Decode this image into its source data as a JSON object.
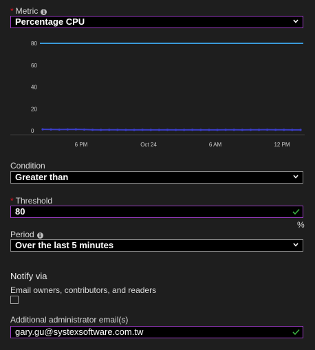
{
  "metric": {
    "label": "Metric",
    "value": "Percentage CPU"
  },
  "chart_data": {
    "type": "line",
    "x_ticks": [
      "6 PM",
      "Oct 24",
      "6 AM",
      "12 PM"
    ],
    "y_ticks": [
      0,
      20,
      40,
      60,
      80
    ],
    "ylim": [
      0,
      80
    ],
    "threshold": 80,
    "series": [
      {
        "values": [
          1.2,
          1.1,
          1.0,
          1.1,
          1.2,
          1.0,
          0.8,
          0.7,
          0.8,
          0.8,
          0.7,
          0.7,
          0.8,
          0.7,
          0.7,
          0.8,
          0.7,
          0.7,
          0.8,
          0.7,
          0.7,
          0.7,
          0.8,
          0.8,
          0.7,
          0.8,
          0.8,
          0.9,
          0.8,
          0.8,
          0.7,
          0.7
        ]
      }
    ],
    "colors": {
      "threshold": "#3a9ad9",
      "series": "#3b3ec9"
    }
  },
  "condition": {
    "label": "Condition",
    "value": "Greater than"
  },
  "threshold": {
    "label": "Threshold",
    "value": "80",
    "unit": "%"
  },
  "period": {
    "label": "Period",
    "value": "Over the last 5 minutes"
  },
  "notify": {
    "title": "Notify via",
    "email_owners_label": "Email owners, contributors, and readers",
    "email_owners_checked": false,
    "admin_email_label": "Additional administrator email(s)",
    "admin_email_value": "gary.gu@systexsoftware.com.tw"
  },
  "colors": {
    "accent_border": "#9b3cc4",
    "check": "#3cb043",
    "required": "#e81123"
  }
}
